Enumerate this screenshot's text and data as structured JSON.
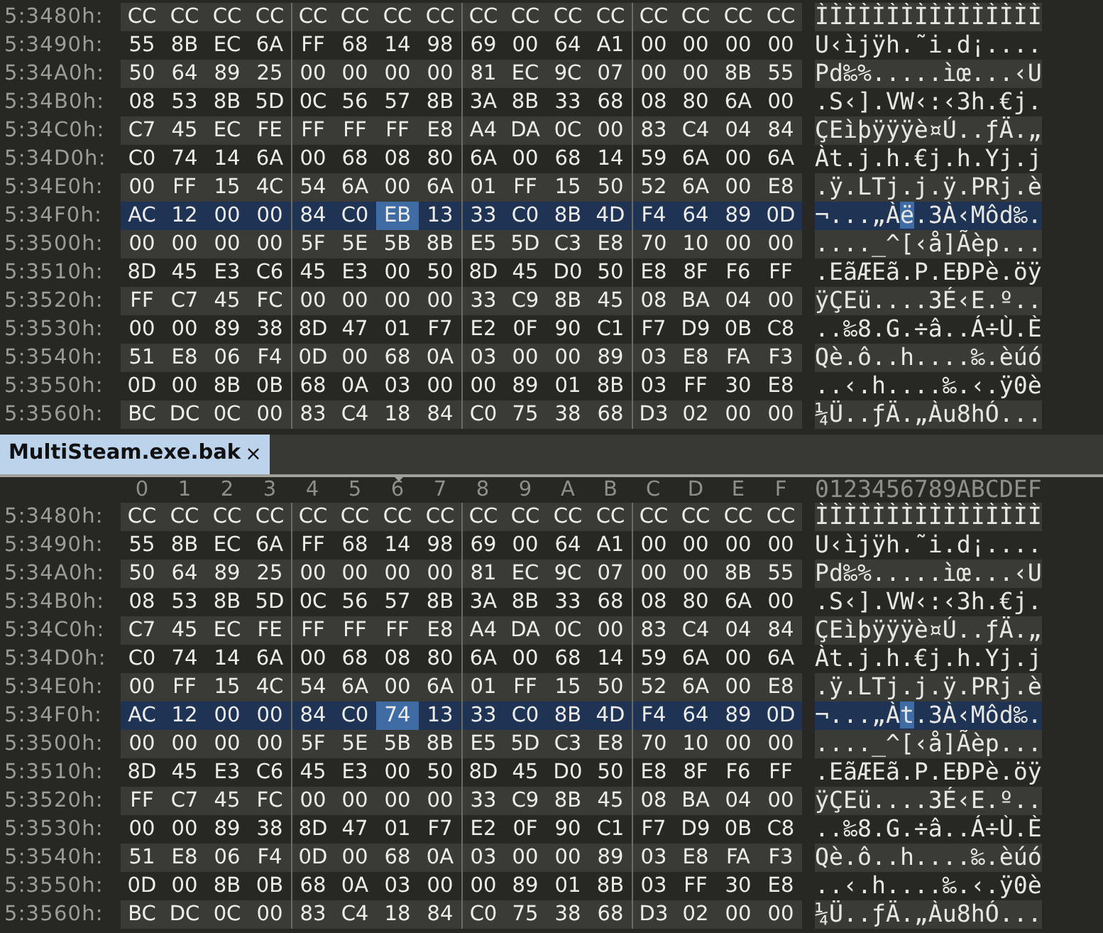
{
  "panes": [
    {
      "rows": [
        {
          "address": "5:3480h:",
          "bytes": [
            "CC",
            "CC",
            "CC",
            "CC",
            "CC",
            "CC",
            "CC",
            "CC",
            "CC",
            "CC",
            "CC",
            "CC",
            "CC",
            "CC",
            "CC",
            "CC"
          ],
          "ascii": "ÌÌÌÌÌÌÌÌÌÌÌÌÌÌÌÌ",
          "selected": false
        },
        {
          "address": "5:3490h:",
          "bytes": [
            "55",
            "8B",
            "EC",
            "6A",
            "FF",
            "68",
            "14",
            "98",
            "69",
            "00",
            "64",
            "A1",
            "00",
            "00",
            "00",
            "00"
          ],
          "ascii": "U‹ìjÿh.˜i.d¡....",
          "selected": false
        },
        {
          "address": "5:34A0h:",
          "bytes": [
            "50",
            "64",
            "89",
            "25",
            "00",
            "00",
            "00",
            "00",
            "81",
            "EC",
            "9C",
            "07",
            "00",
            "00",
            "8B",
            "55"
          ],
          "ascii": "Pd‰%.....ìœ...‹U",
          "selected": false
        },
        {
          "address": "5:34B0h:",
          "bytes": [
            "08",
            "53",
            "8B",
            "5D",
            "0C",
            "56",
            "57",
            "8B",
            "3A",
            "8B",
            "33",
            "68",
            "08",
            "80",
            "6A",
            "00"
          ],
          "ascii": ".S‹].VW‹:‹3h.€j.",
          "selected": false
        },
        {
          "address": "5:34C0h:",
          "bytes": [
            "C7",
            "45",
            "EC",
            "FE",
            "FF",
            "FF",
            "FF",
            "E8",
            "A4",
            "DA",
            "0C",
            "00",
            "83",
            "C4",
            "04",
            "84"
          ],
          "ascii": "ÇEìþÿÿÿè¤Ú..ƒÄ.„",
          "selected": false
        },
        {
          "address": "5:34D0h:",
          "bytes": [
            "C0",
            "74",
            "14",
            "6A",
            "00",
            "68",
            "08",
            "80",
            "6A",
            "00",
            "68",
            "14",
            "59",
            "6A",
            "00",
            "6A"
          ],
          "ascii": "Àt.j.h.€j.h.Yj.j",
          "selected": false
        },
        {
          "address": "5:34E0h:",
          "bytes": [
            "00",
            "FF",
            "15",
            "4C",
            "54",
            "6A",
            "00",
            "6A",
            "01",
            "FF",
            "15",
            "50",
            "52",
            "6A",
            "00",
            "E8"
          ],
          "ascii": ".ÿ.LTj.j.ÿ.PRj.è",
          "selected": false
        },
        {
          "address": "5:34F0h:",
          "bytes": [
            "AC",
            "12",
            "00",
            "00",
            "84",
            "C0",
            "EB",
            "13",
            "33",
            "C0",
            "8B",
            "4D",
            "F4",
            "64",
            "89",
            "0D"
          ],
          "ascii": "¬...„Àë.3À‹Môd‰.",
          "selected": true,
          "cursor": [
            false,
            false,
            false,
            false,
            false,
            false,
            true,
            false,
            false,
            false,
            false,
            false,
            false,
            false,
            false,
            false
          ]
        },
        {
          "address": "5:3500h:",
          "bytes": [
            "00",
            "00",
            "00",
            "00",
            "5F",
            "5E",
            "5B",
            "8B",
            "E5",
            "5D",
            "C3",
            "E8",
            "70",
            "10",
            "00",
            "00"
          ],
          "ascii": "...._^[‹å]Ãèp...",
          "selected": false
        },
        {
          "address": "5:3510h:",
          "bytes": [
            "8D",
            "45",
            "E3",
            "C6",
            "45",
            "E3",
            "00",
            "50",
            "8D",
            "45",
            "D0",
            "50",
            "E8",
            "8F",
            "F6",
            "FF"
          ],
          "ascii": ".EãÆEã.P.EÐPè.öÿ",
          "selected": false
        },
        {
          "address": "5:3520h:",
          "bytes": [
            "FF",
            "C7",
            "45",
            "FC",
            "00",
            "00",
            "00",
            "00",
            "33",
            "C9",
            "8B",
            "45",
            "08",
            "BA",
            "04",
            "00"
          ],
          "ascii": "ÿÇEü....3É‹E.º..",
          "selected": false
        },
        {
          "address": "5:3530h:",
          "bytes": [
            "00",
            "00",
            "89",
            "38",
            "8D",
            "47",
            "01",
            "F7",
            "E2",
            "0F",
            "90",
            "C1",
            "F7",
            "D9",
            "0B",
            "C8"
          ],
          "ascii": "..‰8.G.÷â..Á÷Ù.È",
          "selected": false
        },
        {
          "address": "5:3540h:",
          "bytes": [
            "51",
            "E8",
            "06",
            "F4",
            "0D",
            "00",
            "68",
            "0A",
            "03",
            "00",
            "00",
            "89",
            "03",
            "E8",
            "FA",
            "F3"
          ],
          "ascii": "Qè.ô..h....‰.èúó",
          "selected": false
        },
        {
          "address": "5:3550h:",
          "bytes": [
            "0D",
            "00",
            "8B",
            "0B",
            "68",
            "0A",
            "03",
            "00",
            "00",
            "89",
            "01",
            "8B",
            "03",
            "FF",
            "30",
            "E8"
          ],
          "ascii": "..‹.h....‰.‹.ÿ0è",
          "selected": false
        },
        {
          "address": "5:3560h:",
          "bytes": [
            "BC",
            "DC",
            "0C",
            "00",
            "83",
            "C4",
            "18",
            "84",
            "C0",
            "75",
            "38",
            "68",
            "D3",
            "02",
            "00",
            "00"
          ],
          "ascii": "¼Ü..ƒÄ.„Àu8hÓ...",
          "selected": false
        }
      ]
    },
    {
      "tab": {
        "label": "MultiSteam.exe.bak",
        "close": "×",
        "selected": true
      },
      "column_headers": [
        "0",
        "1",
        "2",
        "3",
        "4",
        "5",
        "6",
        "7",
        "8",
        "9",
        "A",
        "B",
        "C",
        "D",
        "E",
        "F"
      ],
      "ascii_header": "0123456789ABCDEF",
      "rows": [
        {
          "address": "5:3480h:",
          "bytes": [
            "CC",
            "CC",
            "CC",
            "CC",
            "CC",
            "CC",
            "CC",
            "CC",
            "CC",
            "CC",
            "CC",
            "CC",
            "CC",
            "CC",
            "CC",
            "CC"
          ],
          "ascii": "ÌÌÌÌÌÌÌÌÌÌÌÌÌÌÌÌ",
          "selected": false
        },
        {
          "address": "5:3490h:",
          "bytes": [
            "55",
            "8B",
            "EC",
            "6A",
            "FF",
            "68",
            "14",
            "98",
            "69",
            "00",
            "64",
            "A1",
            "00",
            "00",
            "00",
            "00"
          ],
          "ascii": "U‹ìjÿh.˜i.d¡....",
          "selected": false
        },
        {
          "address": "5:34A0h:",
          "bytes": [
            "50",
            "64",
            "89",
            "25",
            "00",
            "00",
            "00",
            "00",
            "81",
            "EC",
            "9C",
            "07",
            "00",
            "00",
            "8B",
            "55"
          ],
          "ascii": "Pd‰%.....ìœ...‹U",
          "selected": false
        },
        {
          "address": "5:34B0h:",
          "bytes": [
            "08",
            "53",
            "8B",
            "5D",
            "0C",
            "56",
            "57",
            "8B",
            "3A",
            "8B",
            "33",
            "68",
            "08",
            "80",
            "6A",
            "00"
          ],
          "ascii": ".S‹].VW‹:‹3h.€j.",
          "selected": false
        },
        {
          "address": "5:34C0h:",
          "bytes": [
            "C7",
            "45",
            "EC",
            "FE",
            "FF",
            "FF",
            "FF",
            "E8",
            "A4",
            "DA",
            "0C",
            "00",
            "83",
            "C4",
            "04",
            "84"
          ],
          "ascii": "ÇEìþÿÿÿè¤Ú..ƒÄ.„",
          "selected": false
        },
        {
          "address": "5:34D0h:",
          "bytes": [
            "C0",
            "74",
            "14",
            "6A",
            "00",
            "68",
            "08",
            "80",
            "6A",
            "00",
            "68",
            "14",
            "59",
            "6A",
            "00",
            "6A"
          ],
          "ascii": "Àt.j.h.€j.h.Yj.j",
          "selected": false
        },
        {
          "address": "5:34E0h:",
          "bytes": [
            "00",
            "FF",
            "15",
            "4C",
            "54",
            "6A",
            "00",
            "6A",
            "01",
            "FF",
            "15",
            "50",
            "52",
            "6A",
            "00",
            "E8"
          ],
          "ascii": ".ÿ.LTj.j.ÿ.PRj.è",
          "selected": false
        },
        {
          "address": "5:34F0h:",
          "bytes": [
            "AC",
            "12",
            "00",
            "00",
            "84",
            "C0",
            "74",
            "13",
            "33",
            "C0",
            "8B",
            "4D",
            "F4",
            "64",
            "89",
            "0D"
          ],
          "ascii": "¬...„Àt.3À‹Môd‰.",
          "selected": true,
          "cursor": [
            false,
            false,
            false,
            false,
            false,
            false,
            true,
            false,
            false,
            false,
            false,
            false,
            false,
            false,
            false,
            false
          ]
        },
        {
          "address": "5:3500h:",
          "bytes": [
            "00",
            "00",
            "00",
            "00",
            "5F",
            "5E",
            "5B",
            "8B",
            "E5",
            "5D",
            "C3",
            "E8",
            "70",
            "10",
            "00",
            "00"
          ],
          "ascii": "...._^[‹å]Ãèp...",
          "selected": false
        },
        {
          "address": "5:3510h:",
          "bytes": [
            "8D",
            "45",
            "E3",
            "C6",
            "45",
            "E3",
            "00",
            "50",
            "8D",
            "45",
            "D0",
            "50",
            "E8",
            "8F",
            "F6",
            "FF"
          ],
          "ascii": ".EãÆEã.P.EÐPè.öÿ",
          "selected": false
        },
        {
          "address": "5:3520h:",
          "bytes": [
            "FF",
            "C7",
            "45",
            "FC",
            "00",
            "00",
            "00",
            "00",
            "33",
            "C9",
            "8B",
            "45",
            "08",
            "BA",
            "04",
            "00"
          ],
          "ascii": "ÿÇEü....3É‹E.º..",
          "selected": false
        },
        {
          "address": "5:3530h:",
          "bytes": [
            "00",
            "00",
            "89",
            "38",
            "8D",
            "47",
            "01",
            "F7",
            "E2",
            "0F",
            "90",
            "C1",
            "F7",
            "D9",
            "0B",
            "C8"
          ],
          "ascii": "..‰8.G.÷â..Á÷Ù.È",
          "selected": false
        },
        {
          "address": "5:3540h:",
          "bytes": [
            "51",
            "E8",
            "06",
            "F4",
            "0D",
            "00",
            "68",
            "0A",
            "03",
            "00",
            "00",
            "89",
            "03",
            "E8",
            "FA",
            "F3"
          ],
          "ascii": "Qè.ô..h....‰.èúó",
          "selected": false
        },
        {
          "address": "5:3550h:",
          "bytes": [
            "0D",
            "00",
            "8B",
            "0B",
            "68",
            "0A",
            "03",
            "00",
            "00",
            "89",
            "01",
            "8B",
            "03",
            "FF",
            "30",
            "E8"
          ],
          "ascii": "..‹.h....‰.‹.ÿ0è",
          "selected": false
        },
        {
          "address": "5:3560h:",
          "bytes": [
            "BC",
            "DC",
            "0C",
            "00",
            "83",
            "C4",
            "18",
            "84",
            "C0",
            "75",
            "38",
            "68",
            "D3",
            "02",
            "00",
            "00"
          ],
          "ascii": "¼Ü..ƒÄ.„Àu8hÓ...",
          "selected": false
        }
      ]
    }
  ]
}
